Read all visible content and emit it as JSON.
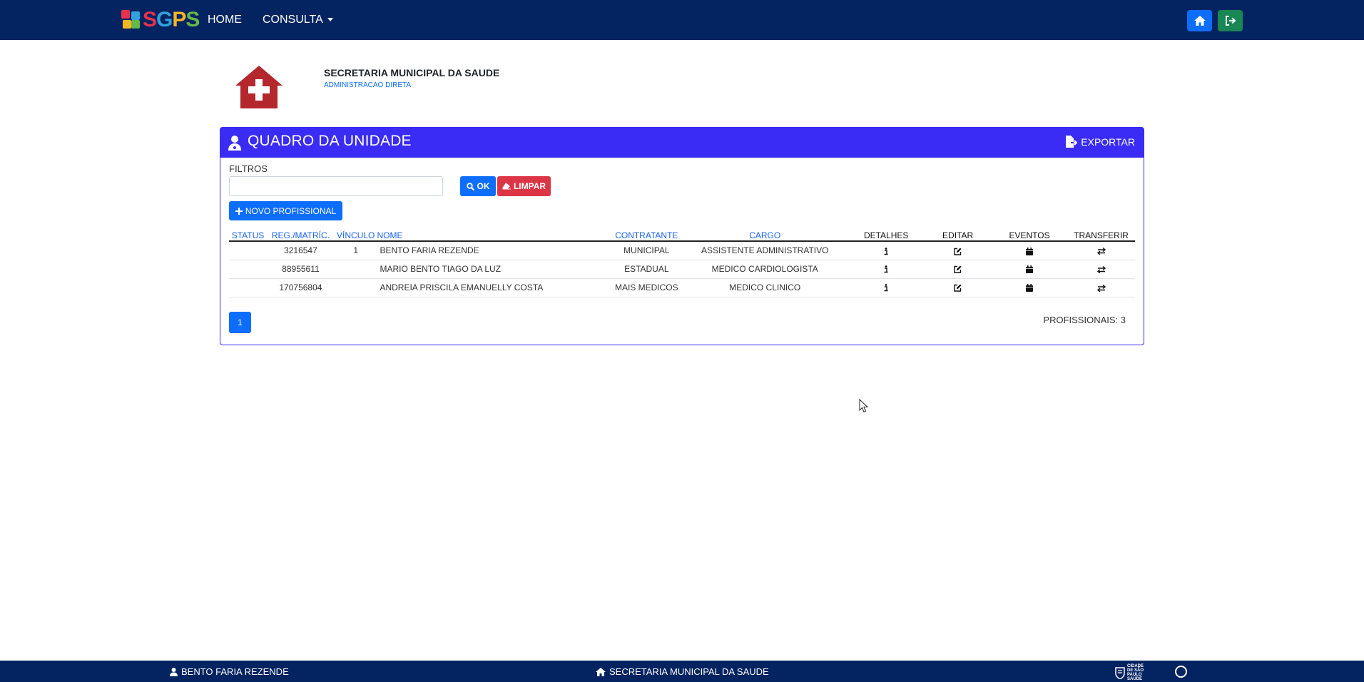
{
  "nav": {
    "brand": "SGPS",
    "brand_parts": [
      "S",
      "G",
      "P",
      "S"
    ],
    "home": "HOME",
    "consulta": "CONSULTA"
  },
  "org": {
    "name": "SECRETARIA MUNICIPAL DA SAUDE",
    "subtitle": "ADMINISTRACAO DIRETA"
  },
  "panel": {
    "title": "QUADRO DA UNIDADE",
    "export_label": "EXPORTAR"
  },
  "filters": {
    "label": "FILTROS",
    "input_value": "",
    "ok_label": "OK",
    "clear_label": "LIMPAR",
    "new_label": "NOVO PROFISSIONAL"
  },
  "table": {
    "headers": [
      "STATUS",
      "REG./MATRÍC.",
      "VÍNCULO",
      "NOME",
      "CONTRATANTE",
      "CARGO",
      "DETALHES",
      "EDITAR",
      "EVENTOS",
      "TRANSFERIR"
    ],
    "rows": [
      {
        "status": "",
        "reg": "3216547",
        "vinculo": "1",
        "nome": "BENTO FARIA REZENDE",
        "contratante": "MUNICIPAL",
        "cargo": "ASSISTENTE ADMINISTRATIVO"
      },
      {
        "status": "",
        "reg": "88955611",
        "vinculo": "",
        "nome": "MARIO BENTO TIAGO DA LUZ",
        "contratante": "ESTADUAL",
        "cargo": "MEDICO CARDIOLOGISTA"
      },
      {
        "status": "",
        "reg": "170756804",
        "vinculo": "",
        "nome": "ANDREIA PRISCILA EMANUELLY COSTA",
        "contratante": "MAIS MEDICOS",
        "cargo": "MEDICO CLINICO"
      }
    ]
  },
  "pagination": {
    "current_page": "1",
    "count_label": "PROFISSIONAIS: 3"
  },
  "footer": {
    "user": "BENTO FARIA REZENDE",
    "org": "SECRETARIA MUNICIPAL DA SAUDE",
    "city_logo": "CIDADE DE SÃO PAULO SAÚDE"
  },
  "colors": {
    "navbar": "#042361",
    "panel_accent": "#3a2cf5",
    "primary": "#0d6efd",
    "danger": "#dc3545",
    "success": "#198754",
    "health_icon": "#b3272d"
  }
}
